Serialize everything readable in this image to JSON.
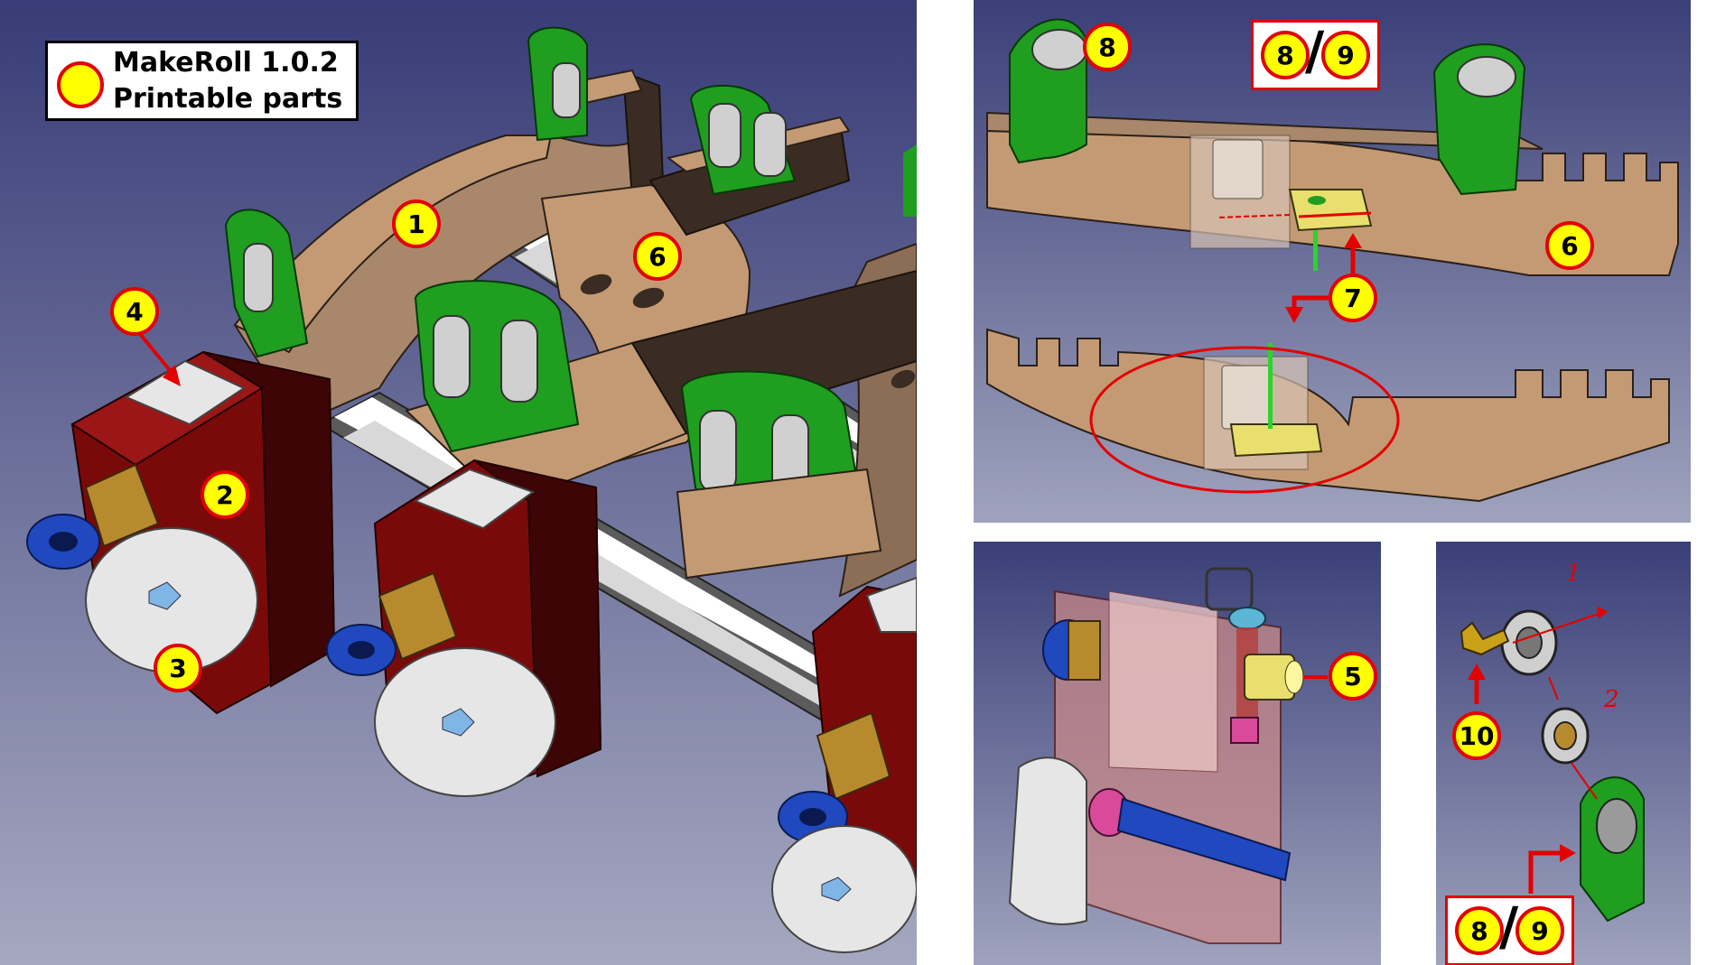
{
  "legend": {
    "line1": "MakeRoll 1.0.2",
    "line2": "Printable parts"
  },
  "callouts": {
    "c1": "1",
    "c2": "2",
    "c3": "3",
    "c4": "4",
    "c5": "5",
    "c6_main": "6",
    "c6_rail": "6",
    "c7": "7",
    "c8_rail": "8",
    "c8_pair_rail": "8",
    "c9_pair_rail": "9",
    "c10": "10",
    "c8_pair_roller": "8",
    "c9_pair_roller": "9"
  },
  "pair_separator": "/",
  "assembly_steps": {
    "step1": "1",
    "step2": "2"
  },
  "colors": {
    "background_top": "#3a3f78",
    "background_bottom": "#9fa3bd",
    "printed_red": "#7a0a0a",
    "printed_green": "#1f9e1f",
    "printed_tan": "#c49a74",
    "printed_white": "#e6e6e6",
    "printed_yellow": "#e8df6e",
    "callout_fill": "#ffff00",
    "callout_border": "#e30000"
  }
}
